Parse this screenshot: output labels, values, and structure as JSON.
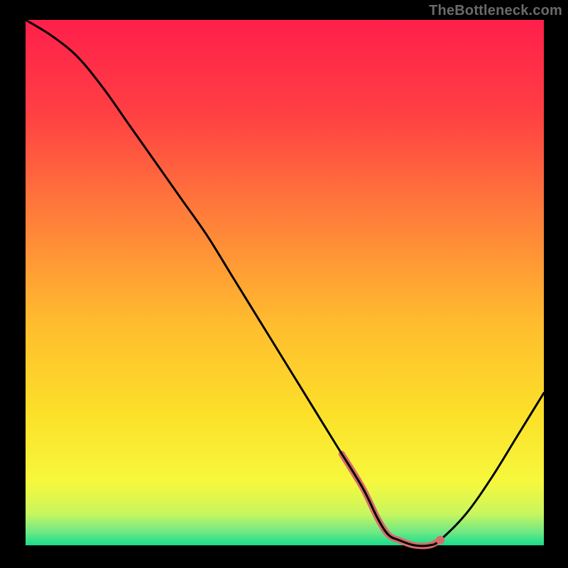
{
  "watermark": "TheBottleneck.com",
  "chart_data": {
    "type": "line",
    "title": "",
    "xlabel": "",
    "ylabel": "",
    "x": [
      0,
      5,
      10,
      15,
      20,
      25,
      30,
      35,
      40,
      45,
      50,
      55,
      60,
      65,
      68,
      70,
      72,
      75,
      78,
      80,
      85,
      90,
      95,
      100
    ],
    "values": [
      100,
      97,
      93,
      87,
      80,
      73,
      66,
      59,
      51,
      43,
      35,
      27,
      19,
      11,
      5,
      2,
      1,
      0,
      0,
      1,
      6,
      13,
      21,
      29
    ],
    "ylim": [
      0,
      100
    ],
    "xlim": [
      0,
      100
    ],
    "highlight_region": {
      "x_start": 61,
      "x_end": 80
    },
    "marker": {
      "x": 80,
      "y": 1
    },
    "grid": false,
    "legend": false,
    "background_gradient": {
      "stops": [
        {
          "pos": 0.0,
          "color": "#ff1f4b"
        },
        {
          "pos": 0.18,
          "color": "#ff4043"
        },
        {
          "pos": 0.38,
          "color": "#ff803a"
        },
        {
          "pos": 0.58,
          "color": "#ffbd2e"
        },
        {
          "pos": 0.75,
          "color": "#fce029"
        },
        {
          "pos": 0.88,
          "color": "#f6f83d"
        },
        {
          "pos": 0.94,
          "color": "#c8f65e"
        },
        {
          "pos": 0.975,
          "color": "#6ee885"
        },
        {
          "pos": 1.0,
          "color": "#17de8c"
        }
      ]
    },
    "annotations": []
  },
  "plot": {
    "outer_size": 800,
    "inner_left": 36,
    "inner_top": 28,
    "inner_width": 730,
    "inner_height": 740,
    "curve_stroke": "#000000",
    "curve_width": 3,
    "highlight_color": "#d76b6b",
    "highlight_width": 9,
    "marker_fill": "#d76b6b",
    "marker_radius": 6
  }
}
